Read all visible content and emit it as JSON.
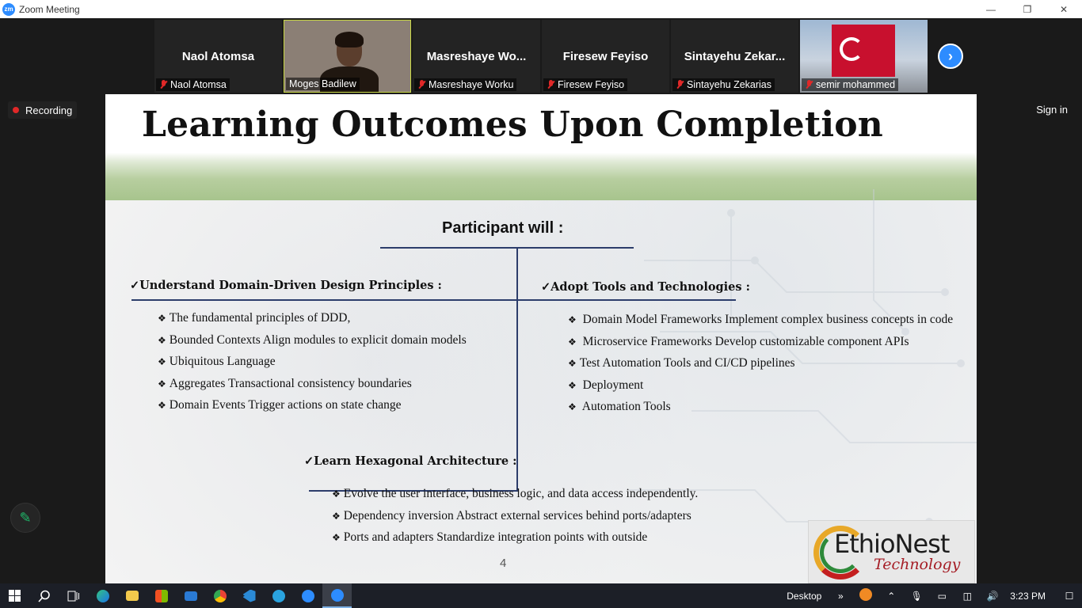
{
  "window": {
    "title": "Zoom Meeting",
    "logo_text": "zm",
    "controls": {
      "minimize": "—",
      "restore": "❐",
      "close": "✕"
    }
  },
  "participants": [
    {
      "display": "Naol Atomsa",
      "label": "Naol Atomsa",
      "muted": true
    },
    {
      "display": "",
      "label": "Moges Badilew",
      "muted": false,
      "video": true
    },
    {
      "display": "Masreshaye  Wo...",
      "label": "Masreshaye Worku",
      "muted": true
    },
    {
      "display": "Firesew Feyiso",
      "label": "Firesew Feyiso",
      "muted": true
    },
    {
      "display": "Sintayehu  Zekar...",
      "label": "Sintayehu Zekarias",
      "muted": true
    },
    {
      "display": "",
      "label": "semir mohammed",
      "muted": true,
      "image": "turkish-flag"
    }
  ],
  "next_icon": "›",
  "recording": {
    "label": "Recording"
  },
  "sign_in": "Sign in",
  "annotate_icon": "✎",
  "slide": {
    "title": "Learning Outcomes Upon Completion",
    "participant_will": "Participant will :",
    "sections": {
      "ddd": {
        "heading": "✓Understand Domain-Driven Design Principles :",
        "items": [
          "The fundamental principles of DDD,",
          "Bounded Contexts Align modules to explicit domain models",
          "Ubiquitous Language",
          "Aggregates Transactional consistency boundaries",
          "Domain Events Trigger actions on state change"
        ]
      },
      "tools": {
        "heading": "✓Adopt Tools and Technologies  :",
        "items": [
          " Domain Model Frameworks Implement complex business concepts in code",
          " Microservice Frameworks Develop customizable component APIs",
          "Test Automation Tools and CI/CD pipelines",
          " Deployment",
          " Automation Tools"
        ]
      },
      "hex": {
        "heading": "✓Learn Hexagonal Architecture :",
        "items": [
          "Evolve the user interface, business logic, and data access independently.",
          "Dependency inversion Abstract external services behind ports/adapters",
          "Ports and adapters Standardize integration points with outside"
        ]
      }
    },
    "bullet_glyph": "❖",
    "page_number": "4",
    "logo": {
      "line1": "EthioNest",
      "line2": "Technology"
    }
  },
  "taskbar": {
    "desktop_label": "Desktop",
    "chevron": "»",
    "time": "3:23 PM",
    "apps": [
      "start-icon",
      "search-icon",
      "task-view-icon",
      "edge-icon",
      "file-explorer-icon",
      "store-icon",
      "mail-icon",
      "chrome-icon",
      "vscode-icon",
      "telegram-icon",
      "zoom-icon",
      "zoom-meeting-icon"
    ]
  },
  "colors": {
    "zoom_blue": "#2d8cff",
    "record_red": "#e02828",
    "slide_bg": "#f3f3f3",
    "header_green": "#a7c48d",
    "line_navy": "#2c3d6b"
  }
}
